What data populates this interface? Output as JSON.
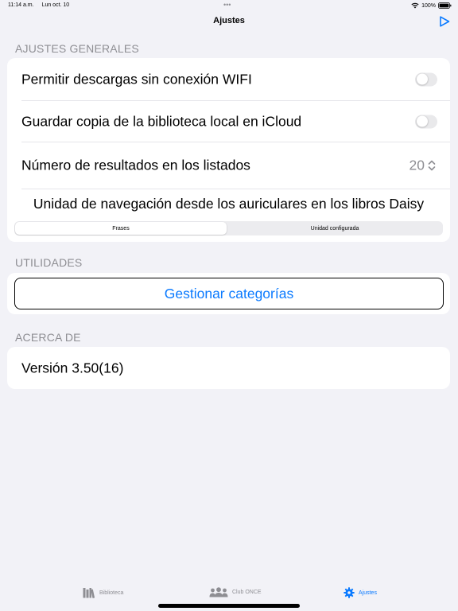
{
  "status_bar": {
    "time": "11:14 a.m.",
    "date": "Lun oct. 10",
    "battery": "100%",
    "dots": "•••"
  },
  "nav": {
    "title": "Ajustes",
    "play_icon": "play-icon",
    "accent_color": "#0a7aff"
  },
  "general": {
    "header": "AJUSTES GENERALES",
    "wifi_downloads_label": "Permitir descargas sin conexión WIFI",
    "wifi_downloads_on": false,
    "icloud_backup_label": "Guardar copia de la biblioteca local en iCloud",
    "icloud_backup_on": false,
    "results_label": "Número de resultados en los listados",
    "results_value": "20",
    "daisy_label": "Unidad de navegación desde los auriculares en los libros Daisy",
    "segments": [
      {
        "label": "Frases",
        "selected": true
      },
      {
        "label": "Unidad configurada",
        "selected": false
      }
    ]
  },
  "utilities": {
    "header": "UTILIDADES",
    "manage_categories_label": "Gestionar categorías"
  },
  "about": {
    "header": "ACERCA DE",
    "version_label": "Versión 3.50(16)"
  },
  "tab_bar": {
    "tabs": [
      {
        "label": "Biblioteca",
        "icon": "library-icon",
        "active": false
      },
      {
        "label": "Club ONCE",
        "icon": "group-icon",
        "active": false
      },
      {
        "label": "Ajustes",
        "icon": "gear-icon",
        "active": true
      }
    ]
  }
}
